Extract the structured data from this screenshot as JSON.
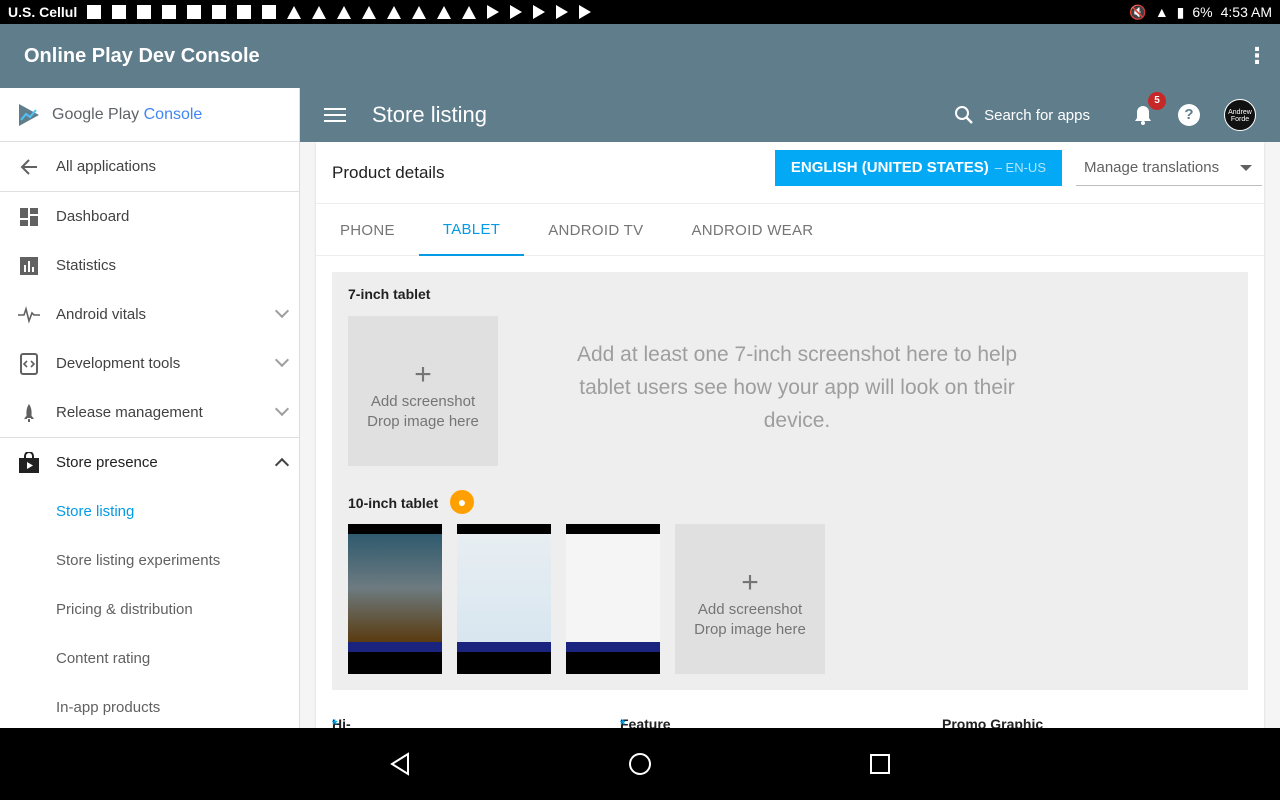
{
  "status_bar": {
    "carrier": "U.S. Cellul",
    "battery": "6%",
    "time": "4:53 AM"
  },
  "app_bar": {
    "title": "Online Play Dev Console"
  },
  "sidebar": {
    "logo": {
      "google_play": "Google Play",
      "console": "Console"
    },
    "back_label": "All applications",
    "items": [
      {
        "label": "Dashboard",
        "icon": "dashboard-icon"
      },
      {
        "label": "Statistics",
        "icon": "bar-chart-icon"
      },
      {
        "label": "Android vitals",
        "icon": "pulse-icon"
      },
      {
        "label": "Development tools",
        "icon": "code-icon"
      },
      {
        "label": "Release management",
        "icon": "rocket-icon"
      },
      {
        "label": "Store presence",
        "icon": "shopping-bag-icon"
      }
    ],
    "sub_items": [
      {
        "label": "Store listing",
        "active": true
      },
      {
        "label": "Store listing experiments"
      },
      {
        "label": "Pricing & distribution"
      },
      {
        "label": "Content rating"
      },
      {
        "label": "In-app products"
      }
    ]
  },
  "header": {
    "page_title": "Store listing",
    "search_label": "Search for apps",
    "notification_count": "5",
    "avatar_text": "Andrew Forde"
  },
  "product": {
    "title": "Product details",
    "language_button": "ENGLISH (UNITED STATES)",
    "language_code": "– EN-US",
    "manage_translations": "Manage translations",
    "tabs": [
      "PHONE",
      "TABLET",
      "ANDROID TV",
      "ANDROID WEAR"
    ],
    "active_tab": "TABLET"
  },
  "screenshots": {
    "seven_inch_label": "7-inch tablet",
    "drop_line1": "Add screenshot",
    "drop_line2": "Drop image here",
    "seven_inch_hint": "Add at least one 7-inch screenshot here to help tablet users see how your app will look on their device.",
    "ten_inch_label": "10-inch tablet"
  },
  "assets": {
    "hires_icon": "Hi-res icon",
    "feature_graphic": "Feature Graphic",
    "promo_graphic": "Promo Graphic",
    "required_marker": "*"
  }
}
